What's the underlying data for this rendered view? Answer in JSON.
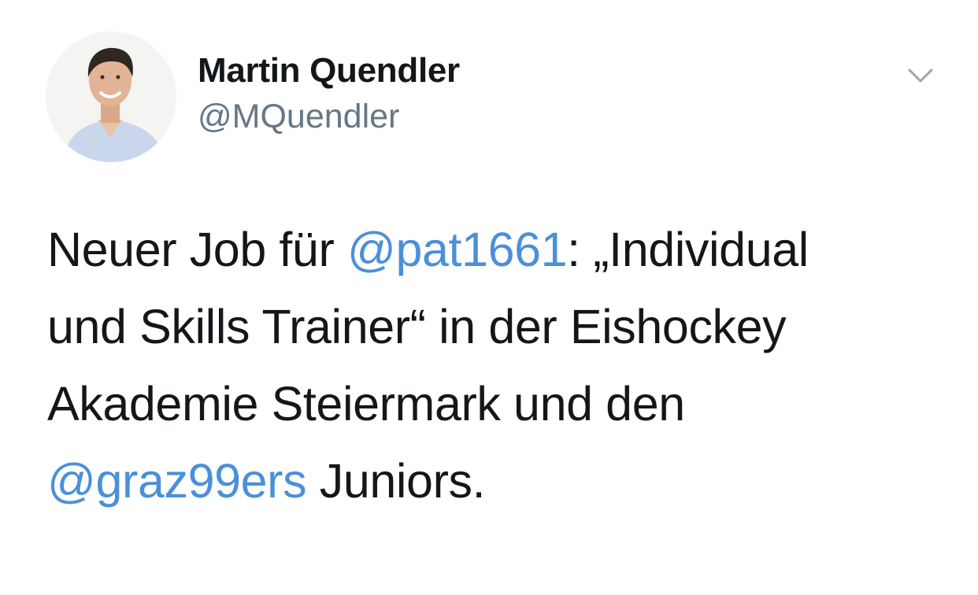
{
  "tweet": {
    "author": {
      "display_name": "Martin Quendler",
      "handle": "@MQuendler",
      "avatar_icon": "profile-photo"
    },
    "menu_icon": "chevron-down-icon",
    "body": {
      "line1": {
        "before": "Neuer Job für ",
        "mention": "@pat1661",
        "after": ": „Individual"
      },
      "line2": "und Skills Trainer“ in der Eishockey",
      "line3": "Akademie Steiermark und den",
      "line4": {
        "mention": "@graz99ers",
        "after": " Juniors."
      }
    },
    "colors": {
      "text": "#14171a",
      "secondary": "#657786",
      "link": "#4a90d9"
    }
  }
}
